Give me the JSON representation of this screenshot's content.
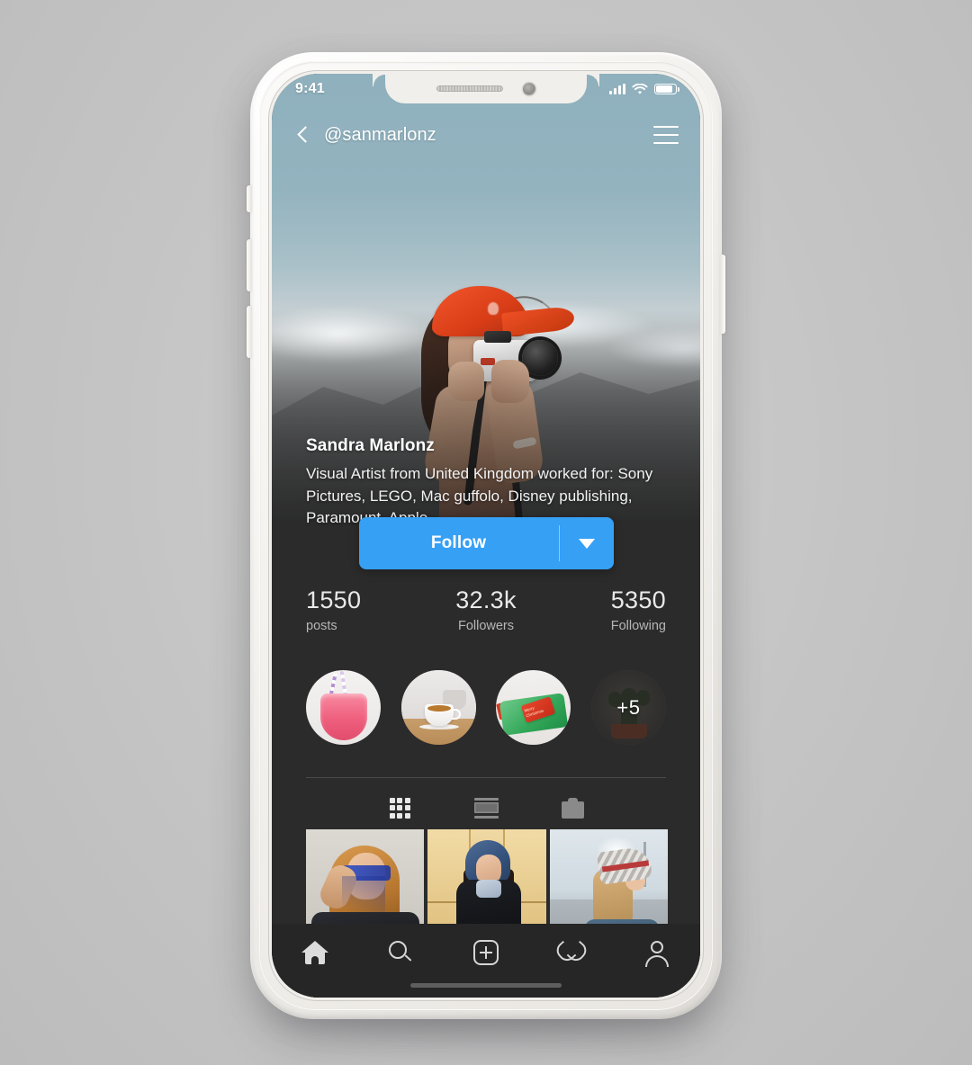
{
  "status_bar": {
    "time": "9:41",
    "signal_icon": "signal-bars-icon",
    "wifi_icon": "wifi-icon",
    "battery_icon": "battery-icon"
  },
  "top_nav": {
    "back_icon": "back-chevron-icon",
    "handle": "@sanmarlonz",
    "menu_icon": "hamburger-menu-icon"
  },
  "cover": {
    "alt": "woman-in-red-cap-holding-camera"
  },
  "profile": {
    "display_name": "Sandra Marlonz",
    "bio": "Visual Artist from United Kingdom worked for: Sony Pictures, LEGO, Mac guffolo, Disney publishing, Paramount, Apple"
  },
  "follow": {
    "label": "Follow",
    "dropdown_icon": "chevron-down-icon",
    "accent_color": "#36a0f5"
  },
  "stats": [
    {
      "value": "1550",
      "label": "posts"
    },
    {
      "value": "32.3k",
      "label": "Followers"
    },
    {
      "value": "5350",
      "label": "Following"
    }
  ],
  "stories": [
    {
      "name": "story-smoothie",
      "overlay": ""
    },
    {
      "name": "story-coffee",
      "overlay": ""
    },
    {
      "name": "story-gift",
      "overlay": ""
    },
    {
      "name": "story-more",
      "overlay": "+5"
    }
  ],
  "story_tag_text": "Merry Christmas",
  "view_tabs": [
    {
      "icon": "grid-view-icon",
      "active": true
    },
    {
      "icon": "feed-view-icon",
      "active": false
    },
    {
      "icon": "tagged-view-icon",
      "active": false
    }
  ],
  "photo_grid": [
    {
      "name": "post-thumbnail-1",
      "alt": "woman-with-blue-sunglasses"
    },
    {
      "name": "post-thumbnail-2",
      "alt": "woman-in-blue-hood"
    },
    {
      "name": "post-thumbnail-3",
      "alt": "woman-in-striped-hat"
    }
  ],
  "bottom_nav": [
    {
      "icon": "home-icon",
      "active": true
    },
    {
      "icon": "search-icon",
      "active": false
    },
    {
      "icon": "add-post-icon",
      "active": false
    },
    {
      "icon": "heart-activity-icon",
      "active": false
    },
    {
      "icon": "profile-person-icon",
      "active": false
    }
  ],
  "colors": {
    "screen_background": "#2b2b2b",
    "nav_background": "#262626",
    "accent_blue": "#36a0f5",
    "sky": "#8fb0bd"
  }
}
